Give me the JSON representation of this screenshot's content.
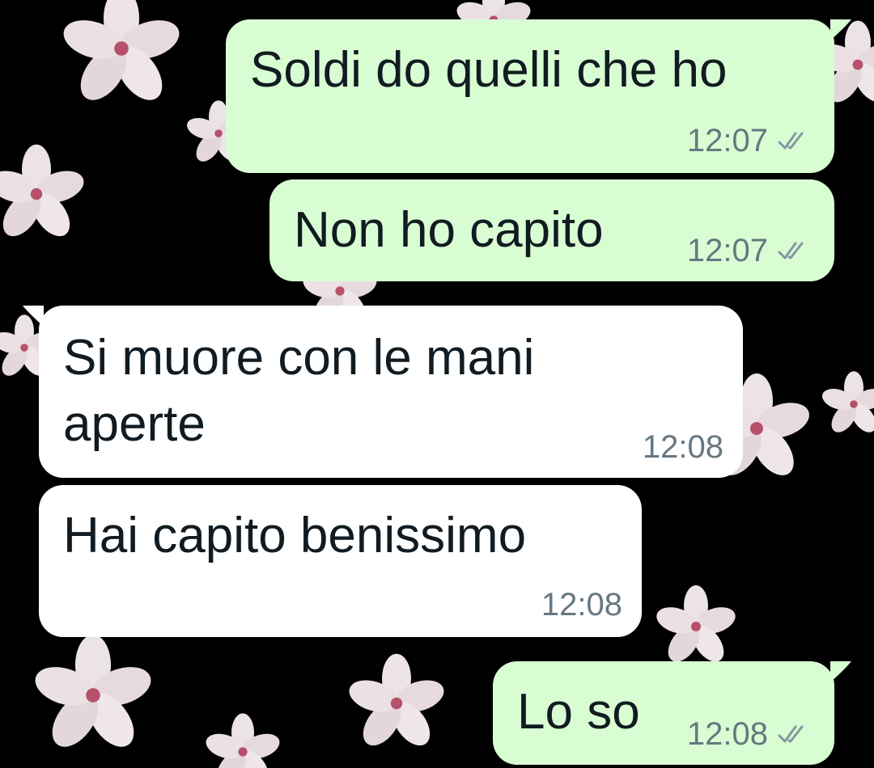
{
  "theme": {
    "outgoing_bubble": "#d9fdd3",
    "incoming_bubble": "#ffffff",
    "text_color": "#111b21",
    "meta_color": "#667781",
    "wallpaper": "#000000",
    "flower_color": "#e9dfe3"
  },
  "messages": [
    {
      "id": "m1",
      "direction": "outgoing",
      "text": "Soldi do quelli che ho",
      "time": "12:07",
      "status_icon": "double-check-icon"
    },
    {
      "id": "m2",
      "direction": "outgoing",
      "text": "Non ho capito",
      "time": "12:07",
      "status_icon": "double-check-icon"
    },
    {
      "id": "m3",
      "direction": "incoming",
      "text": "Si muore con le mani\naperte",
      "time": "12:08"
    },
    {
      "id": "m4",
      "direction": "incoming",
      "text": "Hai capito benissimo",
      "time": "12:08"
    },
    {
      "id": "m5",
      "direction": "outgoing",
      "text": "Lo so",
      "time": "12:08",
      "status_icon": "double-check-icon"
    }
  ]
}
